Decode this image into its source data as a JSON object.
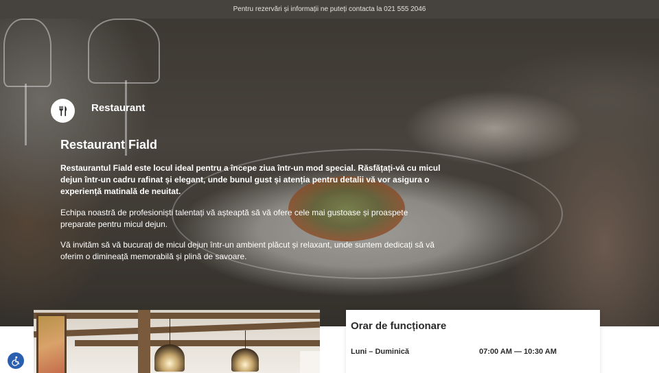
{
  "topbar": {
    "text": "Pentru rezervări și informații ne puteți contacta la 021 555 2046"
  },
  "hero": {
    "brand_icon": "fork-knife-icon",
    "brand_label": "Restaurant",
    "title": "Restaurant Fiald",
    "paragraph_1": "Restaurantul Fiald este locul ideal pentru a începe ziua într-un mod special. Răsfățați-vă cu micul dejun într-un cadru rafinat și elegant, unde bunul gust și atenția pentru detalii vă vor asigura o experiență matinală de neuitat.",
    "paragraph_2": "Echipa noastră de profesioniști talentați vă așteaptă să vă ofere cele mai gustoase și proaspete preparate pentru micul dejun.",
    "paragraph_3": "Vă invităm să vă bucurați de micul dejun într-un ambient plăcut și relaxant, unde suntem dedicați să vă oferim o dimineață memorabilă și plină de savoare."
  },
  "hours": {
    "title": "Orar de funcționare",
    "day": "Luni – Duminică",
    "time": "07:00 AM — 10:30 AM"
  },
  "accessibility": {
    "icon": "accessibility-icon",
    "color": "#2a5fb0"
  },
  "colors": {
    "topbar_bg": "#46433e",
    "text_light": "#ffffff",
    "text_dark": "#2a2a2a"
  }
}
